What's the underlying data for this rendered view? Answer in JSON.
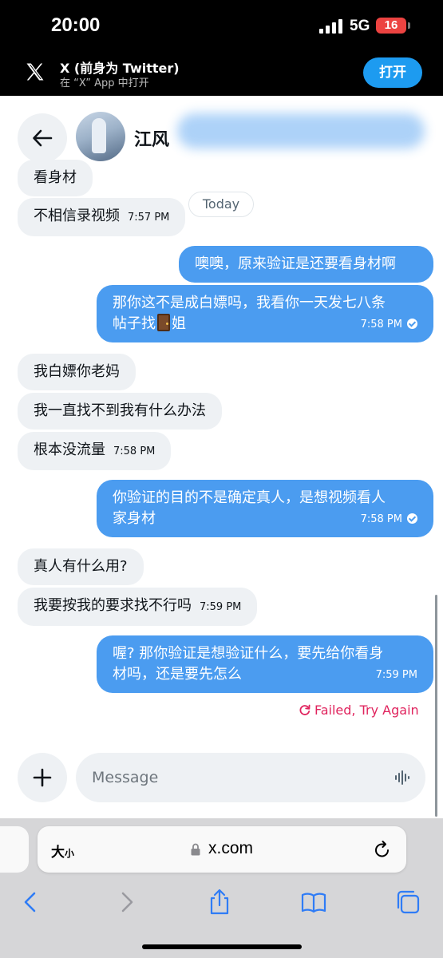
{
  "status_bar": {
    "time": "20:00",
    "network": "5G",
    "battery": "16"
  },
  "app_banner": {
    "title": "X (前身为 Twitter)",
    "subtitle": "在 “X” App 中打开",
    "open_label": "打开"
  },
  "header": {
    "contact_name": "江风"
  },
  "today_label": "Today",
  "messages": [
    {
      "dir": "in",
      "text": "看身材",
      "time": ""
    },
    {
      "dir": "in",
      "text": "不相信录视频",
      "time": "7:57 PM"
    },
    {
      "dir": "out",
      "text": "噢噢，原来验证是还要看身材啊",
      "time": ""
    },
    {
      "dir": "out",
      "line1": "那你这不是成白嫖吗，我看你一天发七八条",
      "line2_pre": "帖子找",
      "line2_post": "姐",
      "time": "7:58 PM"
    },
    {
      "dir": "in",
      "text": "我白嫖你老妈",
      "time": ""
    },
    {
      "dir": "in",
      "text": "我一直找不到我有什么办法",
      "time": ""
    },
    {
      "dir": "in",
      "text": "根本没流量",
      "time": "7:58 PM"
    },
    {
      "dir": "out",
      "line1": "你验证的目的不是确定真人，是想视频看人",
      "line2": "家身材",
      "time": "7:58 PM"
    },
    {
      "dir": "in",
      "text": "真人有什么用?",
      "time": ""
    },
    {
      "dir": "in",
      "text": "我要按我的要求找不行吗",
      "time": "7:59 PM"
    },
    {
      "dir": "out",
      "line1": "喔? 那你验证是想验证什么，要先给你看身",
      "line2": "材吗，还是要先怎么",
      "time": "7:59 PM"
    }
  ],
  "failed_label": "Failed, Try Again",
  "composer": {
    "placeholder": "Message"
  },
  "browser": {
    "text_size_big": "大",
    "text_size_small": "小",
    "url": "x.com"
  },
  "colors": {
    "accent": "#1d9bf0",
    "bubble_out": "#4b9cf0",
    "bubble_in": "#eef1f4",
    "error": "#e0245e",
    "battery": "#ec4341"
  },
  "icons": [
    "x-logo",
    "back-arrow",
    "plus",
    "voice-wave",
    "lock",
    "reload",
    "back",
    "forward",
    "share",
    "bookmarks",
    "tabs",
    "retry",
    "checkmark",
    "door-emoji"
  ]
}
